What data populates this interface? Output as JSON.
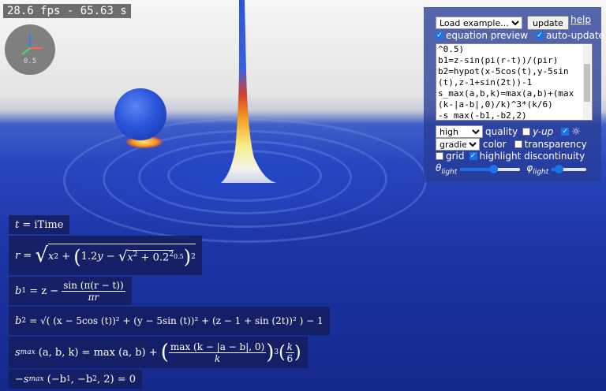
{
  "status": {
    "fps_text": "28.6 fps - 65.63 s",
    "axes_value": "0.5"
  },
  "panel": {
    "example_select": "Load example...",
    "update_button": "update",
    "help_link": "help",
    "equation_preview": {
      "label": "equation preview",
      "checked": true
    },
    "auto_update": {
      "label": "auto-update",
      "checked": true
    },
    "code_lines": [
      "^0.5)",
      "b1=z-sin(pi(r-t))/(pir)",
      "b2=hypot(x-5cos(t),y-5sin",
      "(t),z-1+sin(2t))-1",
      "s_max(a,b,k)=max(a,b)+(max",
      "(k-|a-b|,0)/k)^3*(k/6)",
      "-s_max(-b1,-b2,2)"
    ],
    "quality_select": "high",
    "quality_label": "quality",
    "y_up": {
      "label": "y-up",
      "checked": false
    },
    "light": {
      "icon": "sun-icon",
      "checked": true
    },
    "color_select": "gradient",
    "color_label": "color",
    "transparency": {
      "label": "transparency",
      "checked": false
    },
    "grid": {
      "label": "grid",
      "checked": false
    },
    "highlight": {
      "label": "highlight discontinuity",
      "checked": true
    },
    "theta_label": "θ",
    "theta_sub": "light",
    "theta_value": 0.55,
    "phi_label": "φ",
    "phi_sub": "light",
    "phi_value": 0.2
  },
  "equations": {
    "e0": {
      "lhs": "t",
      "rhs": "= iTime"
    },
    "e1": {
      "lhs": "r",
      "eq": "=",
      "x2": "x",
      "p1": "1.2",
      "y": "y",
      "x2b": "x",
      "c": "0.2",
      "sup2": "2",
      "exp": "0.5",
      "outer_exp": "2"
    },
    "e2": {
      "lhs": "b",
      "sub": "1",
      "rhs": "= z −",
      "num": "sin (π(r − t))",
      "den": "πr"
    },
    "e3": {
      "lhs": "b",
      "sub": "2",
      "rhs": "= √( (x − 5cos (t))² + (y − 5sin (t))² + (z − 1 + sin (2t))² ) − 1"
    },
    "e4": {
      "lhs": "s",
      "sub": "max",
      "args": "(a, b, k) = max (a, b) +",
      "num": "max (k − |a − b|, 0)",
      "den": "k",
      "exp": "3",
      "num2": "k",
      "den2": "6"
    },
    "e5": {
      "text": "−s",
      "sub": "max",
      "args": "(−b",
      "s1": "1",
      "mid": ", −b",
      "s2": "2",
      "end": ", 2) = 0"
    }
  }
}
